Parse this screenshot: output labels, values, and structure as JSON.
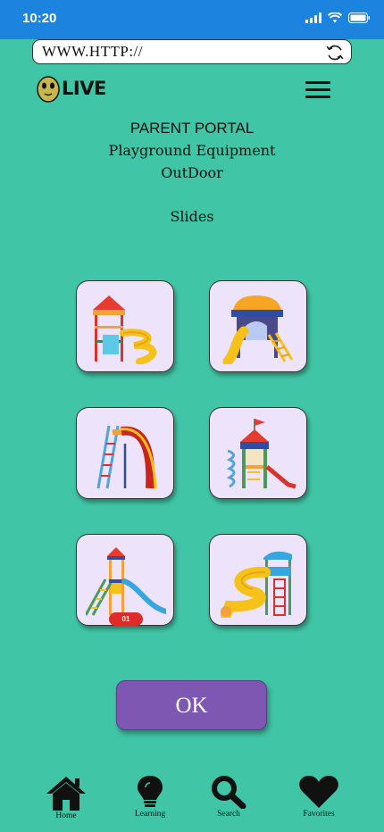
{
  "status_bar": {
    "time": "10:20"
  },
  "browser": {
    "url": "WWW.HTTP://"
  },
  "logo": {
    "text": "LIVE"
  },
  "header": {
    "title": "PARENT PORTAL",
    "line2": "Playground Equipment",
    "line3": "OutDoor",
    "category": "Slides"
  },
  "tiles": [
    {
      "icon": "tower-spiral-slide-icon"
    },
    {
      "icon": "dome-roof-slide-icon"
    },
    {
      "icon": "ladder-curved-slide-icon"
    },
    {
      "icon": "castle-tower-slide-icon"
    },
    {
      "icon": "tower-blue-slide-icon",
      "badge": "01"
    },
    {
      "icon": "yellow-tube-slide-icon"
    }
  ],
  "ok_label": "OK",
  "nav": [
    {
      "label": "Home",
      "icon": "home-icon"
    },
    {
      "label": "Learning",
      "icon": "lightbulb-icon"
    },
    {
      "label": "Search",
      "icon": "search-icon"
    },
    {
      "label": "Favorites",
      "icon": "heart-icon"
    }
  ],
  "colors": {
    "background": "#40c6a6",
    "status_bar": "#1c84de",
    "tile": "#ede3fb",
    "ok_button": "#7e57b2",
    "badge": "#e12b2b"
  }
}
